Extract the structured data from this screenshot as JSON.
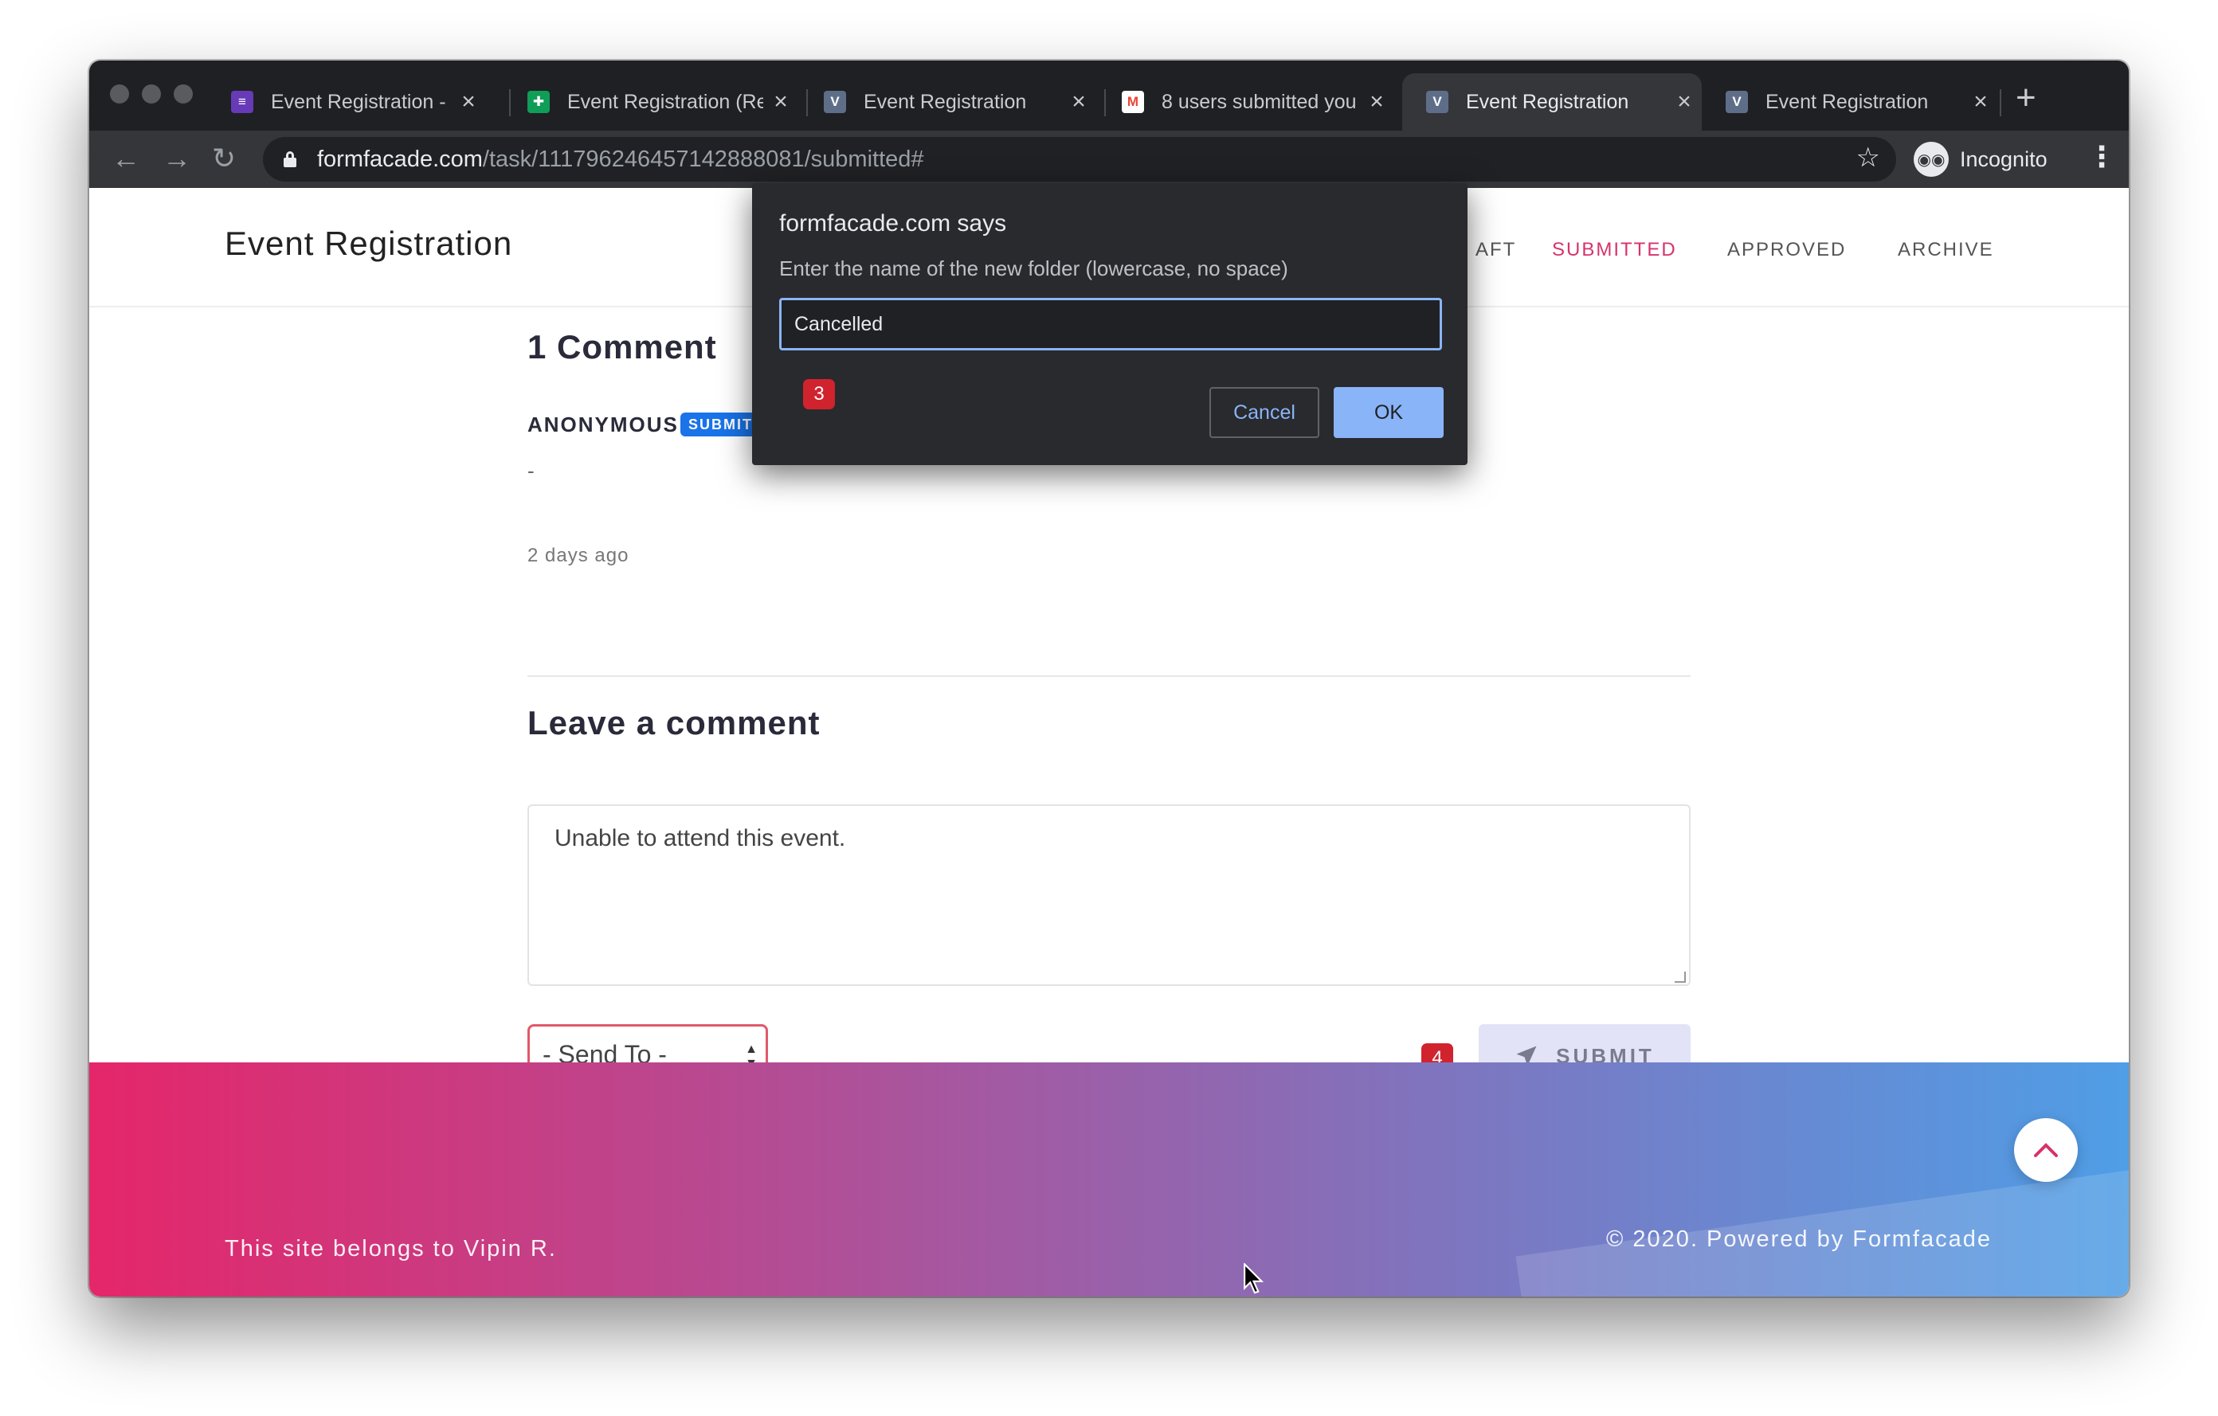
{
  "browser": {
    "tabs": [
      {
        "title": "Event Registration - G",
        "favicon": "form-icon",
        "favicon_color": "#673ab7"
      },
      {
        "title": "Event Registration (Re",
        "favicon": "sheet-icon",
        "favicon_color": "#0f9d58"
      },
      {
        "title": "Event Registration",
        "favicon": "v-icon",
        "favicon_color": "#5f6e88"
      },
      {
        "title": "8 users submitted you",
        "favicon": "gmail-icon",
        "favicon_color": "#ea4335"
      },
      {
        "title": "Event Registration",
        "favicon": "v-icon",
        "favicon_color": "#5f6e88",
        "active": true
      },
      {
        "title": "Event Registration",
        "favicon": "v-icon",
        "favicon_color": "#5f6e88"
      }
    ],
    "favicon_letter": "V",
    "address": {
      "host": "formfacade.com",
      "path": "/task/111796246457142888081/submitted#"
    },
    "profile_label": "Incognito"
  },
  "site": {
    "brand": "Event Registration",
    "nav": [
      {
        "label": "AFT",
        "active": false
      },
      {
        "label": "SUBMITTED",
        "active": true
      },
      {
        "label": "APPROVED",
        "active": false
      },
      {
        "label": "ARCHIVE",
        "active": false
      }
    ]
  },
  "comments": {
    "heading": "1 Comment",
    "author": "ANONYMOUS",
    "badge": "SUBMITTED",
    "body": "-",
    "time": "2 days ago"
  },
  "leave_comment": {
    "heading": "Leave a comment",
    "text": "Unable to attend this event.",
    "send_to_selected": "- Send To -",
    "submit_label": "SUBMIT"
  },
  "footer": {
    "left": "This site belongs to Vipin R.",
    "right": "© 2020. Powered by Formfacade"
  },
  "dialog": {
    "title": "formfacade.com says",
    "message": "Enter the name of the new folder (lowercase, no space)",
    "input_value": "Cancelled",
    "cancel_label": "Cancel",
    "ok_label": "OK"
  },
  "step_badges": {
    "dialog": "3",
    "submit": "4"
  },
  "colors": {
    "accent": "#d6336c",
    "dialog_blue": "#8ab4f8",
    "badge_blue": "#1a73e8",
    "step_red": "#d0232e"
  }
}
